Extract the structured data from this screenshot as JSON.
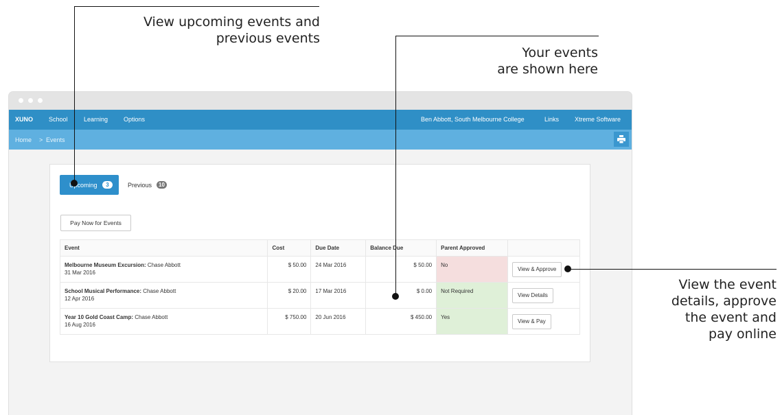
{
  "callouts": {
    "top_left": [
      "View upcoming events and",
      "previous events"
    ],
    "top_right": [
      "Your events",
      "are shown here"
    ],
    "right": [
      "View the event",
      "details, approve",
      "the event and",
      "pay online"
    ]
  },
  "nav": {
    "brand": "XUNO",
    "items": [
      "School",
      "Learning",
      "Options"
    ],
    "user": "Ben Abbott, South Melbourne College",
    "links": "Links",
    "vendor": "Xtreme Software"
  },
  "breadcrumb": {
    "home": "Home",
    "sep": ">",
    "current": "Events"
  },
  "tabs": {
    "upcoming": {
      "label": "Upcoming",
      "count": "3"
    },
    "previous": {
      "label": "Previous",
      "count": "10"
    }
  },
  "pay_now_label": "Pay Now for Events",
  "table": {
    "headers": [
      "Event",
      "Cost",
      "Due Date",
      "Balance Due",
      "Parent Approved",
      ""
    ],
    "rows": [
      {
        "event": "Melbourne Museum Excursion:",
        "person": " Chase Abbott",
        "date": "31 Mar 2016",
        "cost": "$ 50.00",
        "due": "24 Mar 2016",
        "balance": "$ 50.00",
        "approved": "No",
        "action": "View & Approve"
      },
      {
        "event": "School Musical Performance:",
        "person": " Chase Abbott",
        "date": "12 Apr 2016",
        "cost": "$ 20.00",
        "due": "17 Mar 2016",
        "balance": "$ 0.00",
        "approved": "Not Required",
        "action": "View Details"
      },
      {
        "event": "Year 10 Gold Coast Camp:",
        "person": " Chase Abbott",
        "date": "16 Aug 2016",
        "cost": "$ 750.00",
        "due": "20 Jun 2016",
        "balance": "$ 450.00",
        "approved": "Yes",
        "action": "View & Pay"
      }
    ]
  },
  "colors": {
    "nav": "#2f8fc6",
    "crumbbar": "#5fb0e0",
    "tab_active": "#2e8fcb",
    "not_approved": "#f5dede",
    "approved": "#dff0d8"
  }
}
